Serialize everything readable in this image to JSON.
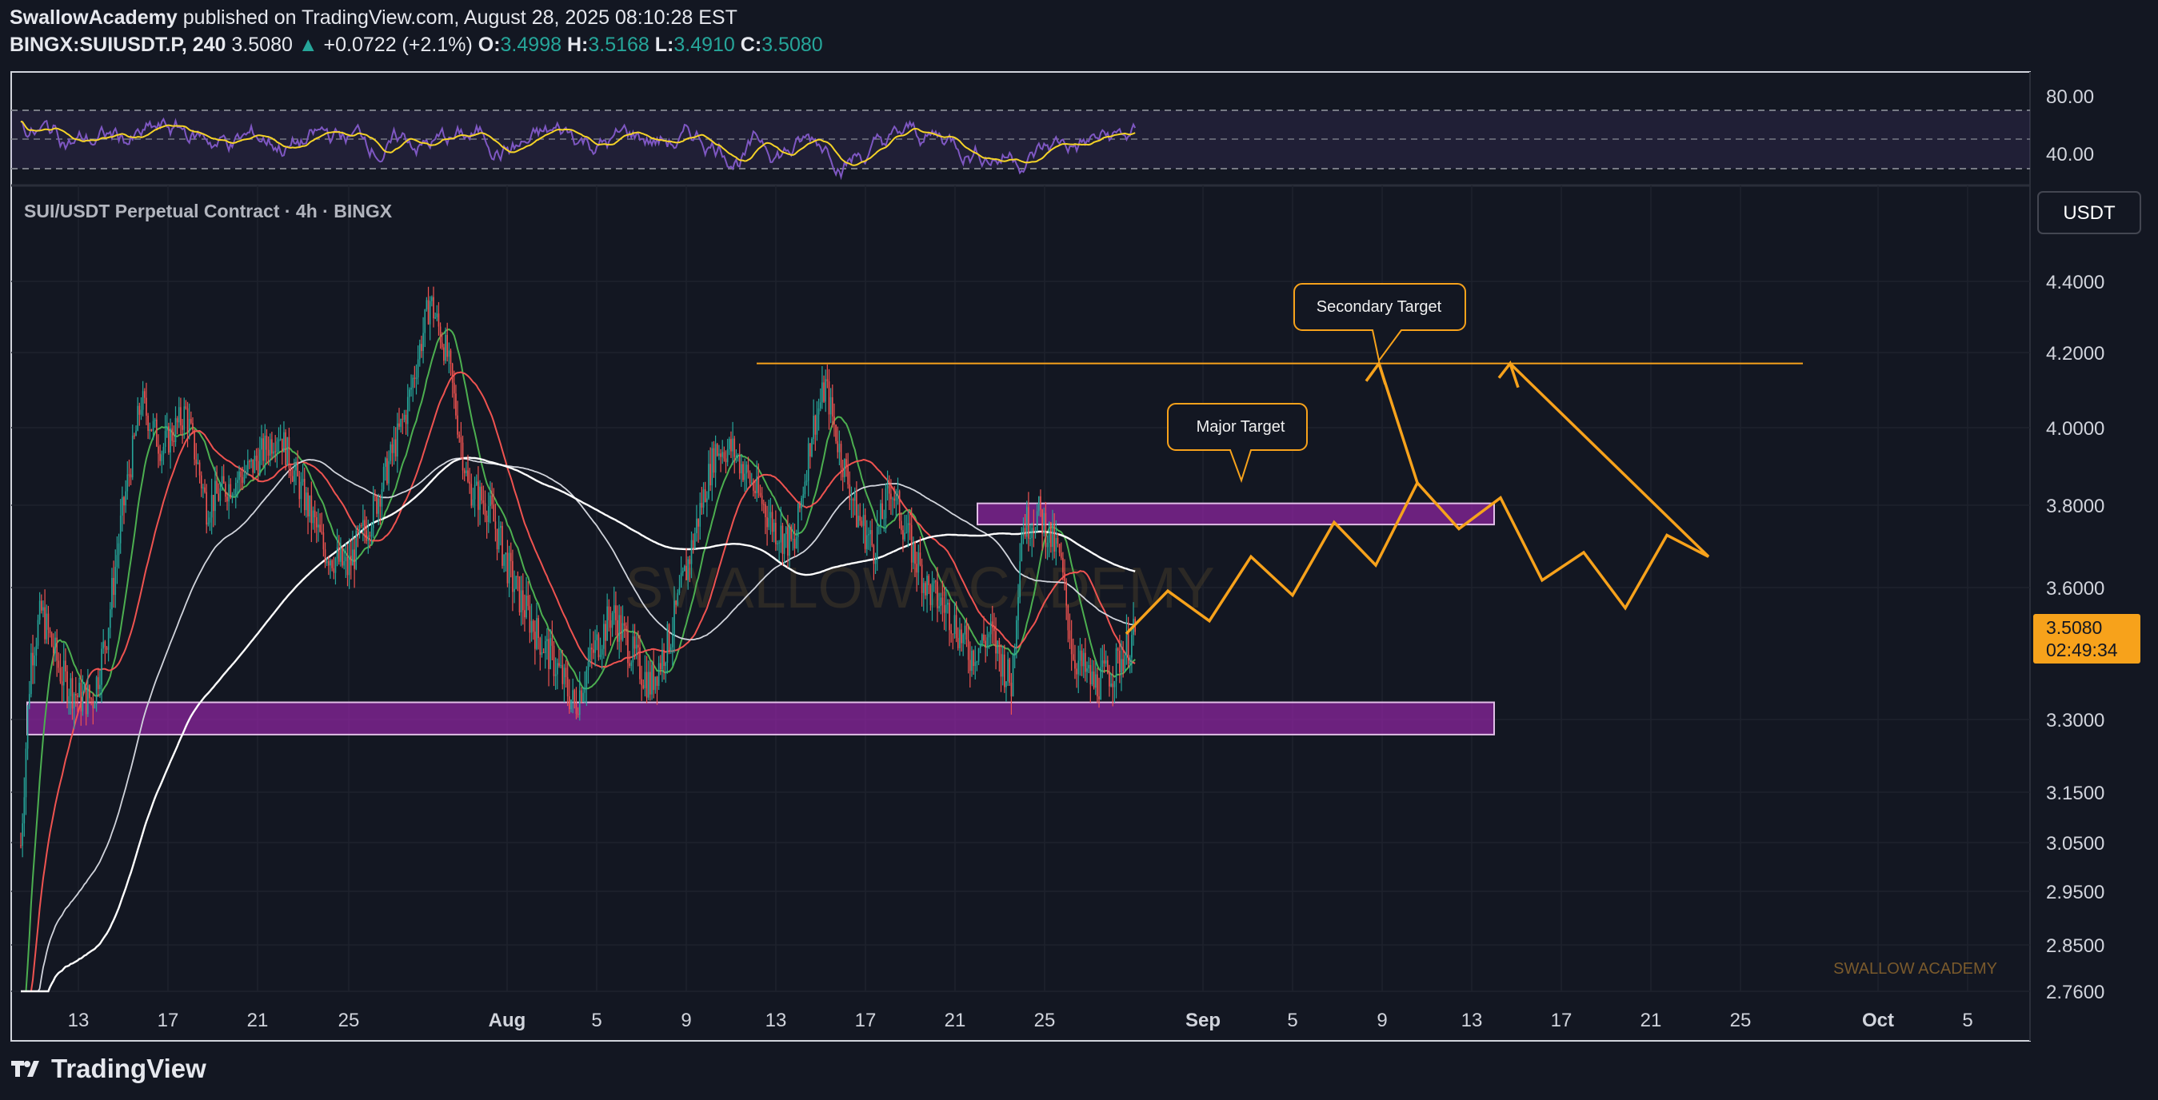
{
  "header": {
    "publisher": "SwallowAcademy",
    "published_text": "published on TradingView.com, August 28, 2025 08:10:28 EST",
    "symbol": "BINGX:SUIUSDT.P, 240",
    "last_price": "3.5080",
    "change": "+0.0722 (+2.1%)",
    "o_label": "O:",
    "o_value": "3.4998",
    "h_label": "H:",
    "h_value": "3.5168",
    "l_label": "L:",
    "l_value": "3.4910",
    "c_label": "C:",
    "c_value": "3.5080"
  },
  "pane_title": "SUI/USDT Perpetual Contract · 4h · BINGX",
  "currency_button": "USDT",
  "watermark": "SWALLOW ACADEMY",
  "watermark_small": "SWALLOW ACADEMY",
  "price_tag": {
    "price": "3.5080",
    "countdown": "02:49:34"
  },
  "annotations": {
    "major": "Major Target",
    "secondary": "Secondary Target"
  },
  "footer": {
    "brand": "TradingView"
  },
  "colors": {
    "background": "#131722",
    "bull": "#26a69a",
    "bear": "#ef5350",
    "zone": "#9c27b0",
    "projection": "#f7a21b",
    "target_line": "#f7a21b",
    "rsi_line": "#7e57c2",
    "rsi_ma": "#f5d327",
    "ma_fast": "#4caf50",
    "ma_mid": "#ef5350"
  },
  "chart_data": [
    {
      "type": "candlestick",
      "title": "SUI/USDT Perpetual Contract · 4h · BINGX",
      "y_ticks": [
        "4.4000",
        "4.2000",
        "4.0000",
        "3.8000",
        "3.6000",
        "3.3000",
        "3.1500",
        "3.0500",
        "2.9500",
        "2.8500",
        "2.7600"
      ],
      "x_ticks": [
        "13",
        "17",
        "21",
        "25",
        "Aug",
        "5",
        "9",
        "13",
        "17",
        "21",
        "25",
        "Sep",
        "5",
        "9",
        "13",
        "17",
        "21",
        "25",
        "Oct",
        "5"
      ],
      "price_anchors": [
        [
          0,
          3.05
        ],
        [
          6,
          3.45
        ],
        [
          12,
          3.55
        ],
        [
          24,
          3.4
        ],
        [
          34,
          3.35
        ],
        [
          42,
          3.35
        ],
        [
          50,
          3.5
        ],
        [
          58,
          3.75
        ],
        [
          70,
          4.08
        ],
        [
          82,
          3.95
        ],
        [
          96,
          4.05
        ],
        [
          108,
          3.8
        ],
        [
          120,
          3.85
        ],
        [
          134,
          3.9
        ],
        [
          150,
          4.0
        ],
        [
          162,
          3.85
        ],
        [
          176,
          3.7
        ],
        [
          190,
          3.65
        ],
        [
          206,
          3.8
        ],
        [
          224,
          4.05
        ],
        [
          238,
          4.35
        ],
        [
          248,
          4.2
        ],
        [
          260,
          3.85
        ],
        [
          272,
          3.8
        ],
        [
          286,
          3.62
        ],
        [
          300,
          3.5
        ],
        [
          312,
          3.42
        ],
        [
          322,
          3.33
        ],
        [
          332,
          3.45
        ],
        [
          344,
          3.55
        ],
        [
          356,
          3.45
        ],
        [
          366,
          3.38
        ],
        [
          378,
          3.5
        ],
        [
          390,
          3.7
        ],
        [
          404,
          3.95
        ],
        [
          414,
          3.95
        ],
        [
          426,
          3.85
        ],
        [
          438,
          3.75
        ],
        [
          450,
          3.7
        ],
        [
          460,
          4.0
        ],
        [
          468,
          4.12
        ],
        [
          476,
          3.95
        ],
        [
          486,
          3.78
        ],
        [
          496,
          3.7
        ],
        [
          506,
          3.85
        ],
        [
          516,
          3.72
        ],
        [
          528,
          3.6
        ],
        [
          540,
          3.55
        ],
        [
          552,
          3.45
        ],
        [
          564,
          3.5
        ],
        [
          576,
          3.38
        ],
        [
          582,
          3.75
        ],
        [
          592,
          3.78
        ],
        [
          604,
          3.68
        ],
        [
          612,
          3.45
        ],
        [
          624,
          3.38
        ],
        [
          636,
          3.42
        ],
        [
          648,
          3.5
        ]
      ],
      "zones": [
        {
          "name": "support",
          "from": 3.27,
          "to": 3.34
        },
        {
          "name": "resistance",
          "from": 3.755,
          "to": 3.805
        }
      ],
      "target_level": 4.18,
      "projection_path": [
        [
          3.5,
          "Aug 28"
        ],
        [
          3.6,
          ""
        ],
        [
          3.53,
          ""
        ],
        [
          3.68,
          ""
        ],
        [
          3.59,
          ""
        ],
        [
          3.76,
          ""
        ],
        [
          3.66,
          ""
        ],
        [
          3.86,
          ""
        ],
        [
          3.745,
          ""
        ],
        [
          3.82,
          ""
        ],
        [
          3.625,
          ""
        ],
        [
          3.69,
          ""
        ],
        [
          3.56,
          ""
        ],
        [
          3.73,
          ""
        ],
        [
          3.68,
          ""
        ],
        [
          4.18,
          ""
        ],
        [
          4.14,
          ""
        ]
      ],
      "rsi": {
        "levels": [
          "80.00",
          "40.00"
        ]
      }
    }
  ]
}
